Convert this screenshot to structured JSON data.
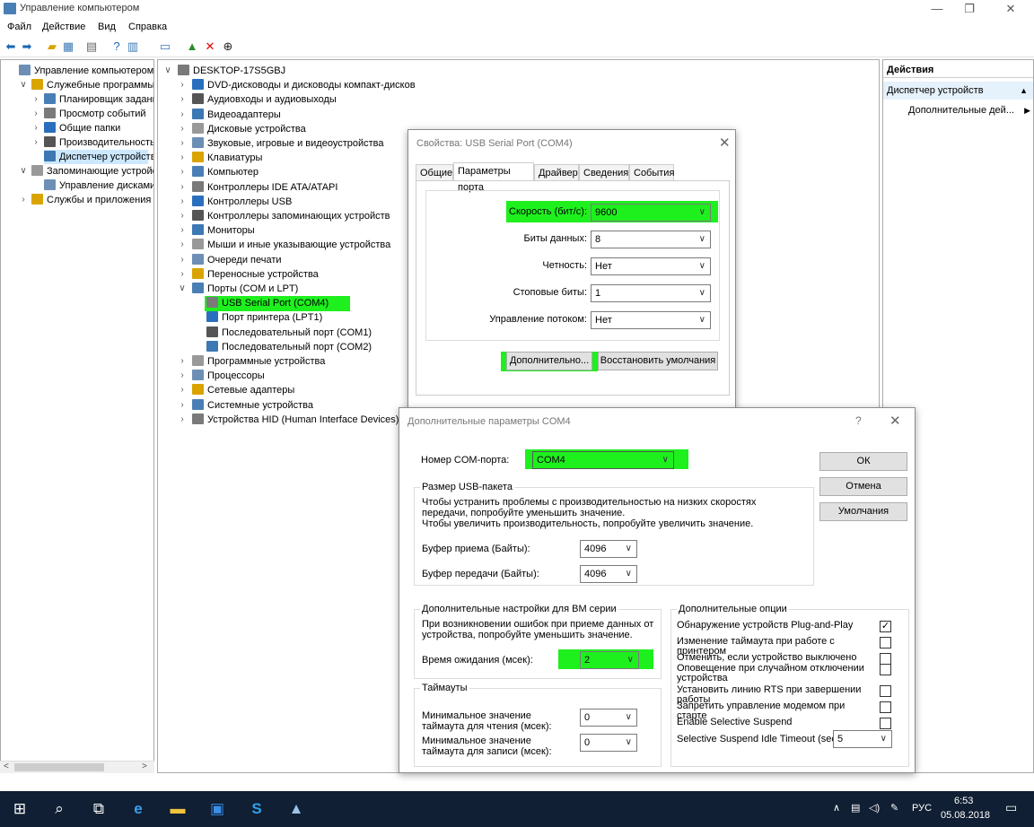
{
  "window": {
    "title": "Управление компьютером"
  },
  "menu": [
    "Файл",
    "Действие",
    "Вид",
    "Справка"
  ],
  "toolbar_icons": [
    "back-arrow-icon",
    "forward-arrow-icon",
    "up-folder-icon",
    "properties-grid-icon",
    "list-view-icon",
    "help-icon",
    "properties-icon",
    "monitor-icon",
    "add-driver-icon",
    "delete-icon",
    "download-icon"
  ],
  "left_tree": [
    {
      "label": "Управление компьютером (л",
      "level": 0,
      "chev": ""
    },
    {
      "label": "Служебные программы",
      "level": 1,
      "chev": "v"
    },
    {
      "label": "Планировщик заданий",
      "level": 2,
      "chev": ">"
    },
    {
      "label": "Просмотр событий",
      "level": 2,
      "chev": ">"
    },
    {
      "label": "Общие папки",
      "level": 2,
      "chev": ">"
    },
    {
      "label": "Производительность",
      "level": 2,
      "chev": ">"
    },
    {
      "label": "Диспетчер устройств",
      "level": 2,
      "chev": "",
      "selected": true
    },
    {
      "label": "Запоминающие устройст",
      "level": 1,
      "chev": "v"
    },
    {
      "label": "Управление дисками",
      "level": 2,
      "chev": ""
    },
    {
      "label": "Службы и приложения",
      "level": 1,
      "chev": ">"
    }
  ],
  "device_tree": [
    {
      "label": "DESKTOP-17S5GBJ",
      "level": 0,
      "chev": "v"
    },
    {
      "label": "DVD-дисководы и дисководы компакт-дисков",
      "level": 1,
      "chev": ">"
    },
    {
      "label": "Аудиовходы и аудиовыходы",
      "level": 1,
      "chev": ">"
    },
    {
      "label": "Видеоадаптеры",
      "level": 1,
      "chev": ">"
    },
    {
      "label": "Дисковые устройства",
      "level": 1,
      "chev": ">"
    },
    {
      "label": "Звуковые, игровые и видеоустройства",
      "level": 1,
      "chev": ">"
    },
    {
      "label": "Клавиатуры",
      "level": 1,
      "chev": ">"
    },
    {
      "label": "Компьютер",
      "level": 1,
      "chev": ">"
    },
    {
      "label": "Контроллеры IDE ATA/ATAPI",
      "level": 1,
      "chev": ">"
    },
    {
      "label": "Контроллеры USB",
      "level": 1,
      "chev": ">"
    },
    {
      "label": "Контроллеры запоминающих устройств",
      "level": 1,
      "chev": ">"
    },
    {
      "label": "Мониторы",
      "level": 1,
      "chev": ">"
    },
    {
      "label": "Мыши и иные указывающие устройства",
      "level": 1,
      "chev": ">"
    },
    {
      "label": "Очереди печати",
      "level": 1,
      "chev": ">"
    },
    {
      "label": "Переносные устройства",
      "level": 1,
      "chev": ">"
    },
    {
      "label": "Порты (COM и LPT)",
      "level": 1,
      "chev": "v"
    },
    {
      "label": "USB Serial Port (COM4)",
      "level": 2,
      "chev": "",
      "highlight": true
    },
    {
      "label": "Порт принтера (LPT1)",
      "level": 2,
      "chev": ""
    },
    {
      "label": "Последовательный порт (COM1)",
      "level": 2,
      "chev": ""
    },
    {
      "label": "Последовательный порт (COM2)",
      "level": 2,
      "chev": ""
    },
    {
      "label": "Программные устройства",
      "level": 1,
      "chev": ">"
    },
    {
      "label": "Процессоры",
      "level": 1,
      "chev": ">"
    },
    {
      "label": "Сетевые адаптеры",
      "level": 1,
      "chev": ">"
    },
    {
      "label": "Системные устройства",
      "level": 1,
      "chev": ">"
    },
    {
      "label": "Устройства HID (Human Interface Devices)",
      "level": 1,
      "chev": ">"
    }
  ],
  "actions": {
    "header": "Действия",
    "section": "Диспетчер устройств",
    "item": "Дополнительные дей..."
  },
  "props_dialog": {
    "title": "Свойства: USB Serial Port (COM4)",
    "tabs": [
      "Общие",
      "Параметры порта",
      "Драйвер",
      "Сведения",
      "События"
    ],
    "active_tab": 1,
    "fields": [
      {
        "label": "Скорость (бит/с):",
        "value": "9600"
      },
      {
        "label": "Биты данных:",
        "value": "8"
      },
      {
        "label": "Четность:",
        "value": "Нет"
      },
      {
        "label": "Стоповые биты:",
        "value": "1"
      },
      {
        "label": "Управление потоком:",
        "value": "Нет"
      }
    ],
    "advanced_button": "Дополнительно...",
    "restore_button": "Восстановить умолчания"
  },
  "adv_dialog": {
    "title": "Дополнительные параметры COM4",
    "help": "?",
    "com_label": "Номер COM-порта:",
    "com_value": "COM4",
    "ok": "ОК",
    "cancel": "Отмена",
    "defaults": "Умолчания",
    "usb_group": "Размер USB-пакета",
    "usb_text1": "Чтобы устранить проблемы с производительностью на низких скоростях передачи, попробуйте уменьшить значение.",
    "usb_text2": "Чтобы увеличить производительность, попробуйте увеличить значение.",
    "rx_label": "Буфер приема (Байты):",
    "rx_value": "4096",
    "tx_label": "Буфер передачи (Байты):",
    "tx_value": "4096",
    "bm_group": "Дополнительные настройки для BM серии",
    "bm_text": "При возникновении ошибок при приеме данных от устройства, попробуйте уменьшить значение.",
    "latency_label": "Время ожидания (мсек):",
    "latency_value": "2",
    "timeouts_group": "Таймауты",
    "read_to_label": "Минимальное значение таймаута для чтения (мсек):",
    "read_to_value": "0",
    "write_to_label": "Минимальное значение таймаута для записи (мсек):",
    "write_to_value": "0",
    "options_group": "Дополнительные опции",
    "options": [
      {
        "label": "Обнаружение устройств Plug-and-Play",
        "checked": true
      },
      {
        "label": "Изменение таймаута при работе с принтером",
        "checked": false
      },
      {
        "label": "Отменить, если устройство выключено",
        "checked": false
      },
      {
        "label": "Оповещение при случайном отключении устройства",
        "checked": false
      },
      {
        "label": "Установить линию RTS при завершении работы",
        "checked": false
      },
      {
        "label": "Запретить управление модемом при старте",
        "checked": false
      },
      {
        "label": "Enable Selective Suspend",
        "checked": false
      }
    ],
    "idle_label": "Selective Suspend Idle Timeout (secs):",
    "idle_value": "5"
  },
  "taskbar": {
    "lang": "РУС",
    "time": "6:53",
    "date": "05.08.2018"
  },
  "colors": {
    "highlight": "#1ef01e",
    "taskbar": "#101f33",
    "selection": "#cce8ff"
  }
}
